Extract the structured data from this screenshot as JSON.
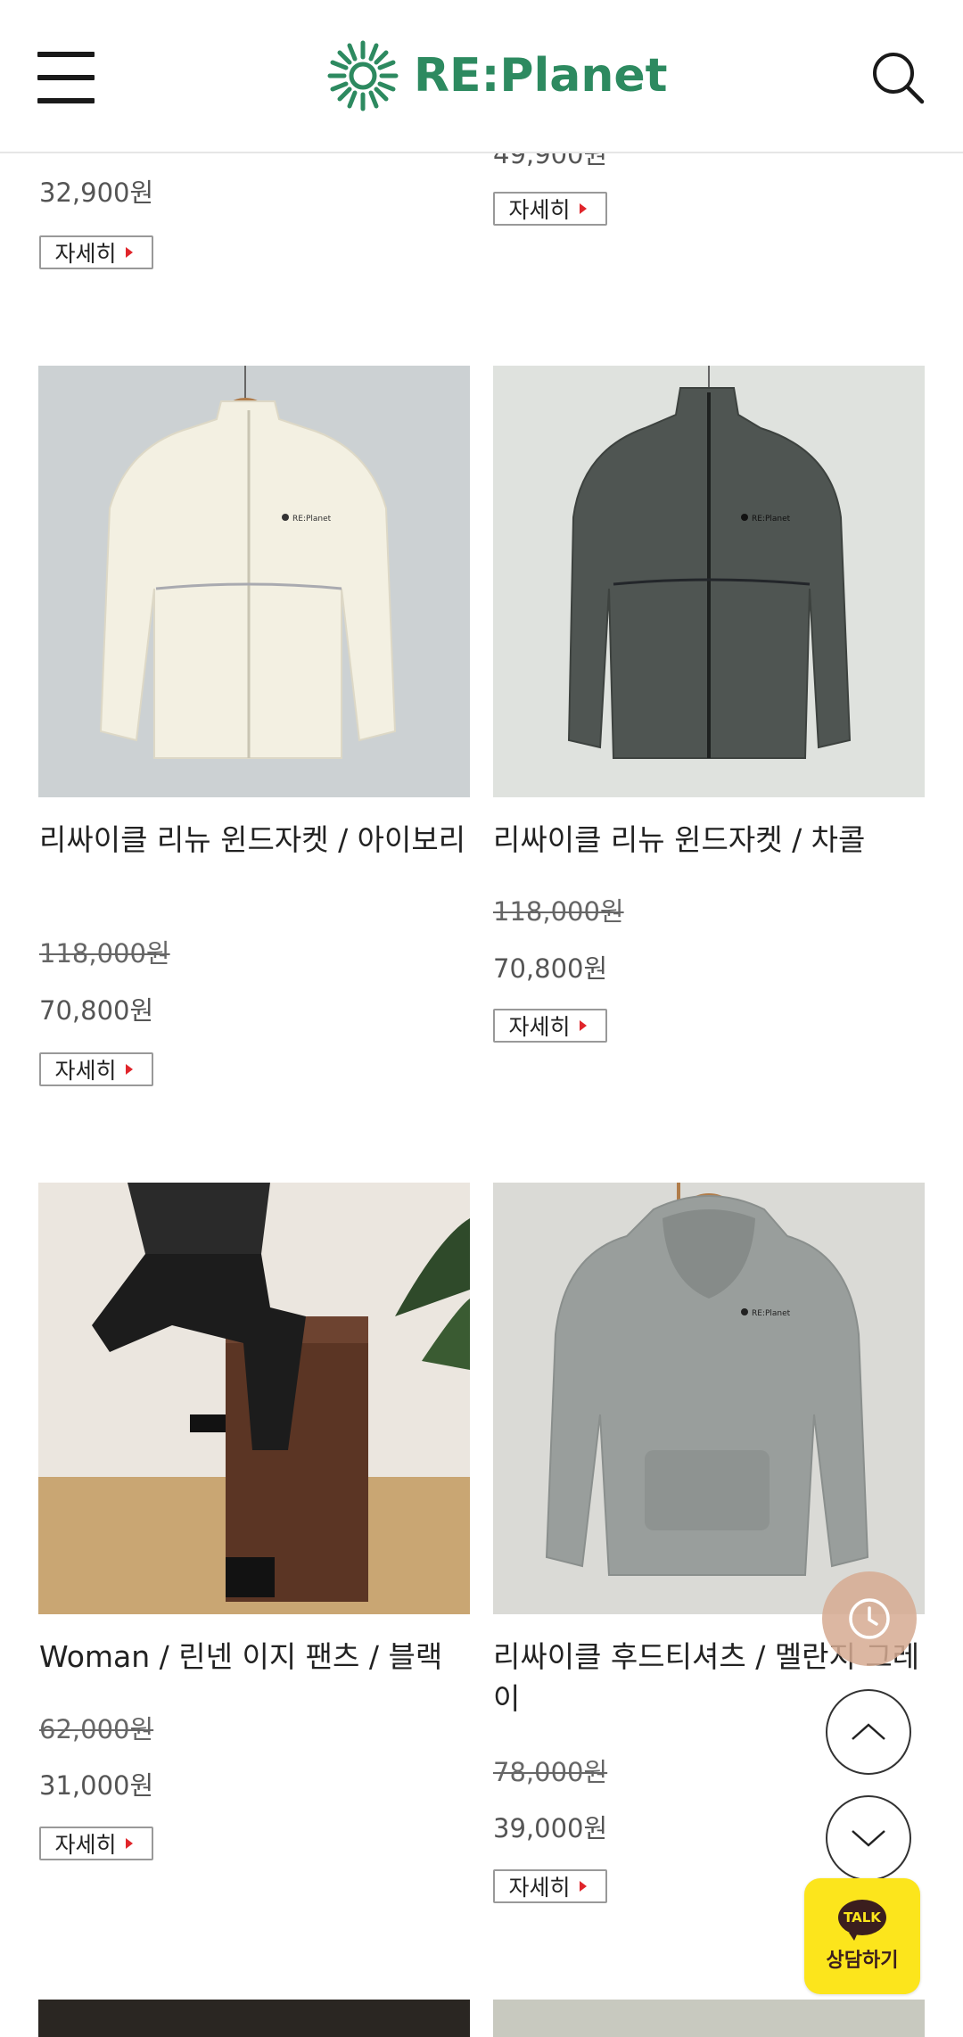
{
  "header": {
    "brand": "RE:Planet",
    "colors": {
      "brand": "#2d8a60"
    }
  },
  "top_partial": {
    "left": {
      "price": "32,900원",
      "detail_label": "자세히"
    },
    "right": {
      "price_cropped": "49,900원",
      "detail_label": "자세히"
    }
  },
  "products": [
    {
      "name": "리싸이클 리뉴 윈드자켓 / 아이보리",
      "old_price": "118,000원",
      "price": "70,800원",
      "detail_label": "자세히",
      "image": "ivory-wind-jacket"
    },
    {
      "name": "리싸이클 리뉴 윈드자켓 / 차콜",
      "old_price": "118,000원",
      "price": "70,800원",
      "detail_label": "자세히",
      "image": "charcoal-wind-jacket"
    },
    {
      "name": "Woman / 린넨 이지 팬츠 / 블랙",
      "old_price": "62,000원",
      "price": "31,000원",
      "detail_label": "자세히",
      "image": "black-linen-pants"
    },
    {
      "name": "리싸이클 후드티셔츠 / 멜란지 그레이",
      "old_price": "78,000원",
      "price": "39,000원",
      "detail_label": "자세히",
      "image": "melange-grey-hoodie"
    }
  ],
  "floating": {
    "recent_icon": "clock-icon",
    "scroll_up_icon": "chevron-up-icon",
    "scroll_down_icon": "chevron-down-icon",
    "kakao_badge": "TALK",
    "kakao_label": "상담하기"
  }
}
